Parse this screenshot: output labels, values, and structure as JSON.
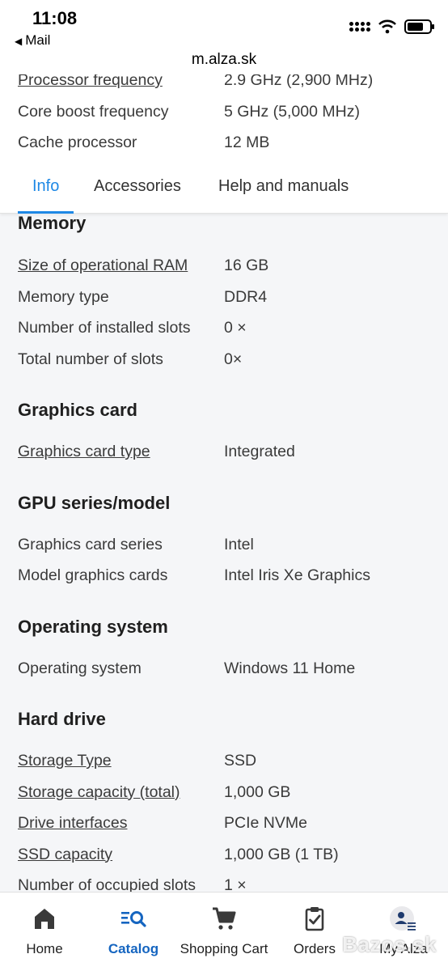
{
  "status_bar": {
    "time": "11:08",
    "back_app": "Mail",
    "url": "m.alza.sk"
  },
  "top_specs": [
    {
      "label": "Processor frequency",
      "value": "2.9 GHz (2,900 MHz)"
    },
    {
      "label": "Core boost frequency",
      "value": "5 GHz (5,000 MHz)"
    },
    {
      "label": "Cache processor",
      "value": "12 MB"
    }
  ],
  "tabs": [
    {
      "label": "Info",
      "active": true
    },
    {
      "label": "Accessories",
      "active": false
    },
    {
      "label": "Help and manuals",
      "active": false
    }
  ],
  "sections": {
    "memory": {
      "title": "Memory",
      "rows": [
        {
          "label": "Size of operational RAM",
          "value": "16 GB"
        },
        {
          "label": "Memory type",
          "value": "DDR4"
        },
        {
          "label": "Number of installed slots",
          "value": "0 ×"
        },
        {
          "label": "Total number of slots",
          "value": "0×"
        }
      ]
    },
    "graphics": {
      "title": "Graphics card",
      "rows": [
        {
          "label": "Graphics card type",
          "value": "Integrated"
        }
      ]
    },
    "gpu": {
      "title": "GPU series/model",
      "rows": [
        {
          "label": "Graphics card series",
          "value": "Intel"
        },
        {
          "label": "Model graphics cards",
          "value": "Intel Iris Xe Graphics"
        }
      ]
    },
    "os": {
      "title": "Operating system",
      "rows": [
        {
          "label": "Operating system",
          "value": "Windows 11 Home"
        }
      ]
    },
    "drive": {
      "title": "Hard drive",
      "rows": [
        {
          "label": "Storage Type",
          "value": "SSD"
        },
        {
          "label": "Storage capacity (total)",
          "value": "1,000 GB"
        },
        {
          "label": "Drive interfaces",
          "value": "PCIe NVMe"
        },
        {
          "label": "SSD capacity",
          "value": "1,000 GB (1 TB)"
        },
        {
          "label": "Number of occupied slots",
          "value": "1 ×"
        }
      ]
    }
  },
  "bottom_nav": [
    {
      "label": "Home",
      "icon": "home-icon",
      "active": false
    },
    {
      "label": "Catalog",
      "icon": "catalog-search-icon",
      "active": true
    },
    {
      "label": "Shopping Cart",
      "icon": "cart-icon",
      "active": false
    },
    {
      "label": "Orders",
      "icon": "clipboard-check-icon",
      "active": false
    },
    {
      "label": "My Alza",
      "icon": "user-menu-icon",
      "active": false
    }
  ],
  "watermark": "Bazos.sk",
  "colors": {
    "accent": "#1e88e5",
    "nav_active": "#1565c0",
    "background": "#f5f6f8"
  }
}
